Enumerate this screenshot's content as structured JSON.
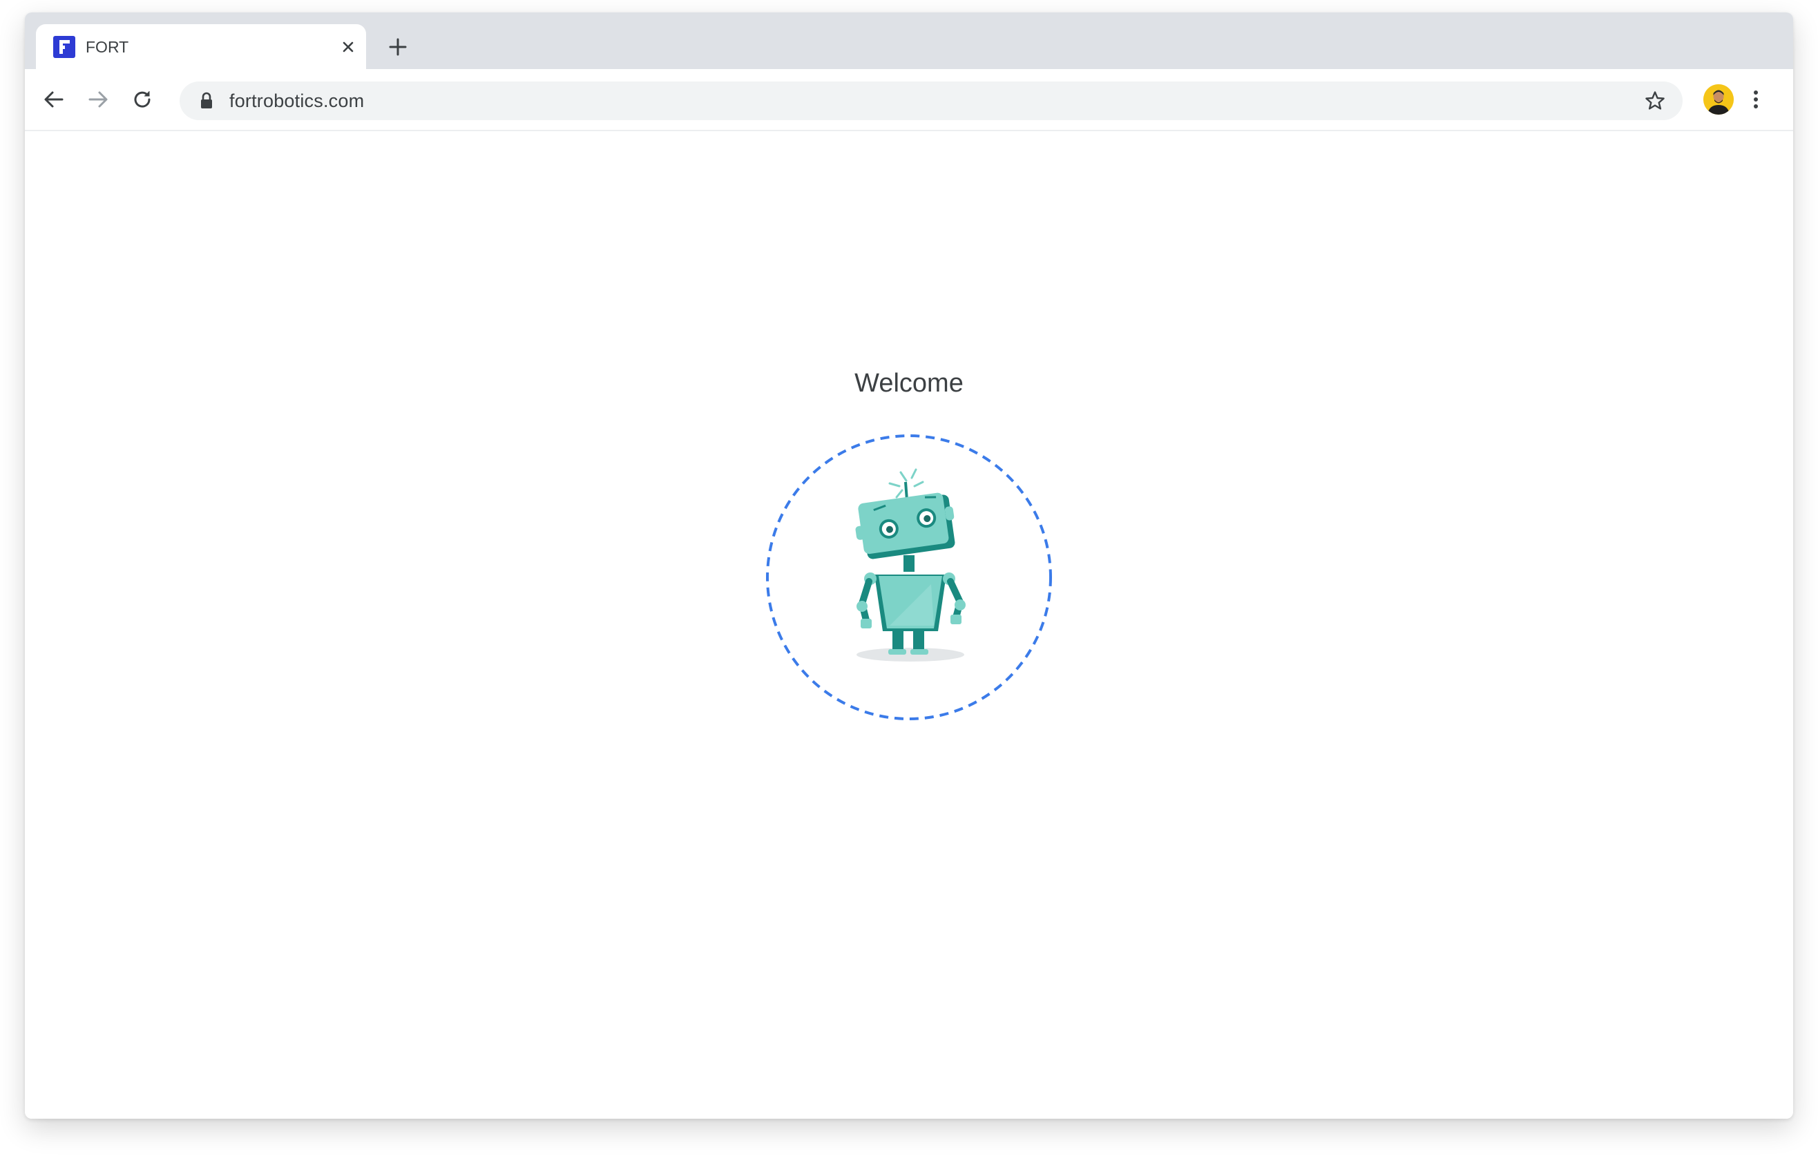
{
  "browser": {
    "tab": {
      "title": "FORT",
      "favicon": "fort-logo-icon",
      "favicon_color": "#2d3bd4"
    },
    "new_tab_icon": "plus-icon",
    "address_bar": {
      "url": "fortrobotics.com",
      "secure_icon": "lock-icon",
      "bookmark_icon": "star-icon"
    },
    "nav": {
      "back_icon": "arrow-left-icon",
      "forward_icon": "arrow-right-icon",
      "reload_icon": "reload-icon"
    },
    "profile_icon": "avatar",
    "menu_icon": "kebab-menu-icon"
  },
  "page": {
    "heading": "Welcome",
    "illustration": "robot-illustration",
    "ring_color": "#3b7be9",
    "robot_color": "#7dd3c8",
    "robot_dark_color": "#1a8a80"
  }
}
